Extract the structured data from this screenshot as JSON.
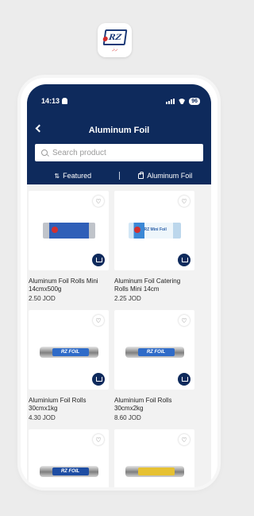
{
  "status_bar": {
    "time": "14:13",
    "battery": "96"
  },
  "header": {
    "title": "Aluminum Foil"
  },
  "search": {
    "placeholder": "Search product"
  },
  "filters": {
    "sort_label": "Featured",
    "category_label": "Aluminum Foil"
  },
  "products": [
    {
      "name": "Aluminum Foil Rolls Mini 14cmx500g",
      "price": "2.50 JOD",
      "image": "foil-box-dark"
    },
    {
      "name": "Aluminum Foil Catering Rolls Mini 14cm",
      "price": "2.25 JOD",
      "image": "foil-box-light",
      "image_text": "RZ Mini Foil"
    },
    {
      "name": "Aluminium Foil Rolls 30cmx1kg",
      "price": "4.30 JOD",
      "image": "foil-roll",
      "image_text": "RZ FOIL"
    },
    {
      "name": "Aluminium Foil Rolls 30cmx2kg",
      "price": "8.60 JOD",
      "image": "foil-roll",
      "image_text": "RZ FOIL"
    },
    {
      "name": "",
      "price": "",
      "image": "foil-roll-orange",
      "image_text": "RZ FOIL"
    },
    {
      "name": "",
      "price": "",
      "image": "foil-roll-yellow"
    }
  ],
  "colors": {
    "primary": "#0e2a5c",
    "background": "#f2f2f2"
  }
}
